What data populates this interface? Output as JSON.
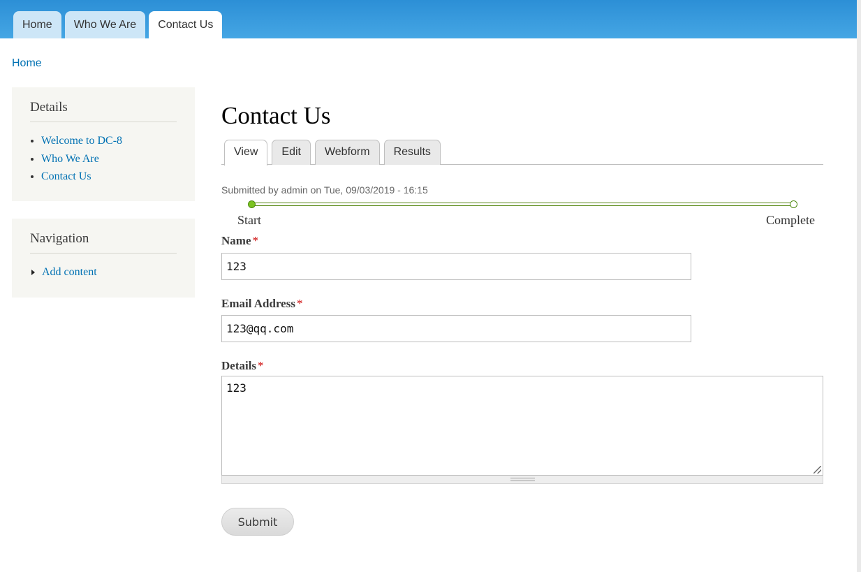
{
  "header": {
    "tabs": [
      {
        "label": "Home",
        "active": false
      },
      {
        "label": "Who We Are",
        "active": false
      },
      {
        "label": "Contact Us",
        "active": true
      }
    ]
  },
  "breadcrumb": {
    "home": "Home"
  },
  "sidebar": {
    "details": {
      "title": "Details",
      "links": [
        "Welcome to DC-8",
        "Who We Are",
        "Contact Us"
      ]
    },
    "navigation": {
      "title": "Navigation",
      "links": [
        "Add content"
      ]
    }
  },
  "main": {
    "title": "Contact Us",
    "tabs": [
      {
        "label": "View",
        "active": true
      },
      {
        "label": "Edit",
        "active": false
      },
      {
        "label": "Webform",
        "active": false
      },
      {
        "label": "Results",
        "active": false
      }
    ],
    "submitted": "Submitted by admin on Tue, 09/03/2019 - 16:15",
    "progress": {
      "start_label": "Start",
      "end_label": "Complete"
    },
    "form": {
      "name_label": "Name",
      "name_value": "123",
      "email_label": "Email Address",
      "email_value": "123@qq.com",
      "details_label": "Details",
      "details_value": "123",
      "required_marker": "*",
      "submit_label": "Submit"
    }
  },
  "colors": {
    "header_blue": "#2c8fd6",
    "link_blue": "#0071b3",
    "progress_green": "#7bc321",
    "required_red": "#cc0000"
  }
}
